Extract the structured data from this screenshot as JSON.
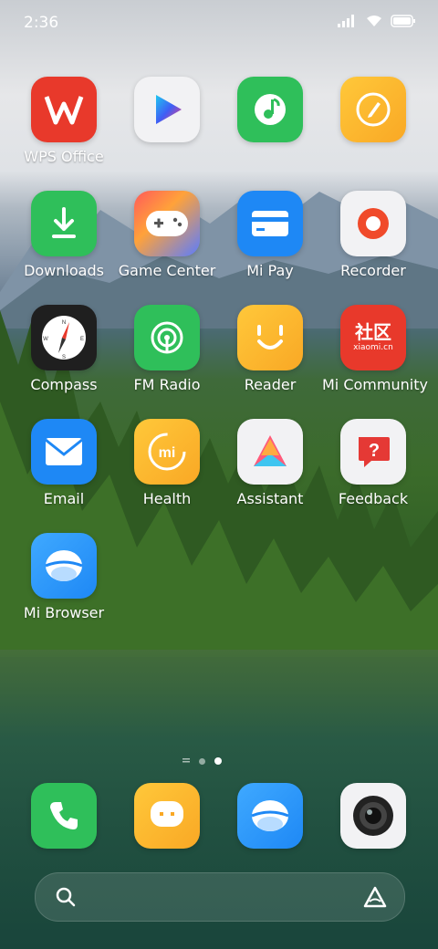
{
  "status_bar": {
    "time": "2:36"
  },
  "apps": [
    {
      "label": "WPS Office",
      "icon": "wps-icon"
    },
    {
      "label": "",
      "icon": "video-player-icon"
    },
    {
      "label": "",
      "icon": "music-icon"
    },
    {
      "label": "",
      "icon": "notes-icon"
    },
    {
      "label": "Downloads",
      "icon": "download-icon"
    },
    {
      "label": "Game Center",
      "icon": "gamepad-icon"
    },
    {
      "label": "Mi Pay",
      "icon": "card-icon"
    },
    {
      "label": "Recorder",
      "icon": "record-icon"
    },
    {
      "label": "Compass",
      "icon": "compass-icon"
    },
    {
      "label": "FM Radio",
      "icon": "radio-icon"
    },
    {
      "label": "Reader",
      "icon": "smile-icon"
    },
    {
      "label": "Mi Community",
      "icon": "community-icon",
      "badge_text_1": "社区",
      "badge_text_2": "xiaomi.cn"
    },
    {
      "label": "Email",
      "icon": "mail-icon"
    },
    {
      "label": "Health",
      "icon": "health-icon",
      "logo_text": "mi"
    },
    {
      "label": "Assistant",
      "icon": "assistant-icon"
    },
    {
      "label": "Feedback",
      "icon": "feedback-icon",
      "glyph": "?"
    },
    {
      "label": "Mi Browser",
      "icon": "browser-icon"
    }
  ],
  "dock": [
    {
      "icon": "phone-icon"
    },
    {
      "icon": "messages-icon"
    },
    {
      "icon": "browser-icon"
    },
    {
      "icon": "camera-icon"
    }
  ],
  "page_indicator": {
    "pages": 3,
    "active": 3
  },
  "colors": {
    "wps": "#e8392b",
    "downloads": "#2fbf5a",
    "mipay": "#1e88f5",
    "recorder": "#f04a2a",
    "fm": "#2fbf5a",
    "reader": "#f9a825",
    "community": "#e8392b",
    "email": "#1e88f5",
    "health": "#f9a825",
    "feedback": "#e53935"
  }
}
